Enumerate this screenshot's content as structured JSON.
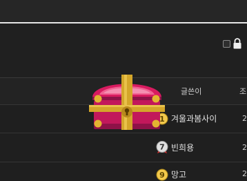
{
  "header": {
    "col_author": "글쓴이",
    "col_views": "조"
  },
  "rows": [
    {
      "rank": "1",
      "author": "겨울과봄사이",
      "trail": "2"
    },
    {
      "rank": "7",
      "author": "빈희용",
      "trail": "2"
    },
    {
      "rank": "9",
      "author": "망고",
      "trail": "2"
    }
  ],
  "icons": [
    "checkbox-icon",
    "lock-icon",
    "treasure-chest-icon",
    "rank-badge-icon"
  ],
  "colors": {
    "background": "#1f1f1f",
    "accent_line": "#e6e6e6",
    "chest_body": "#c2185b",
    "chest_gold": "#d4a62a"
  }
}
